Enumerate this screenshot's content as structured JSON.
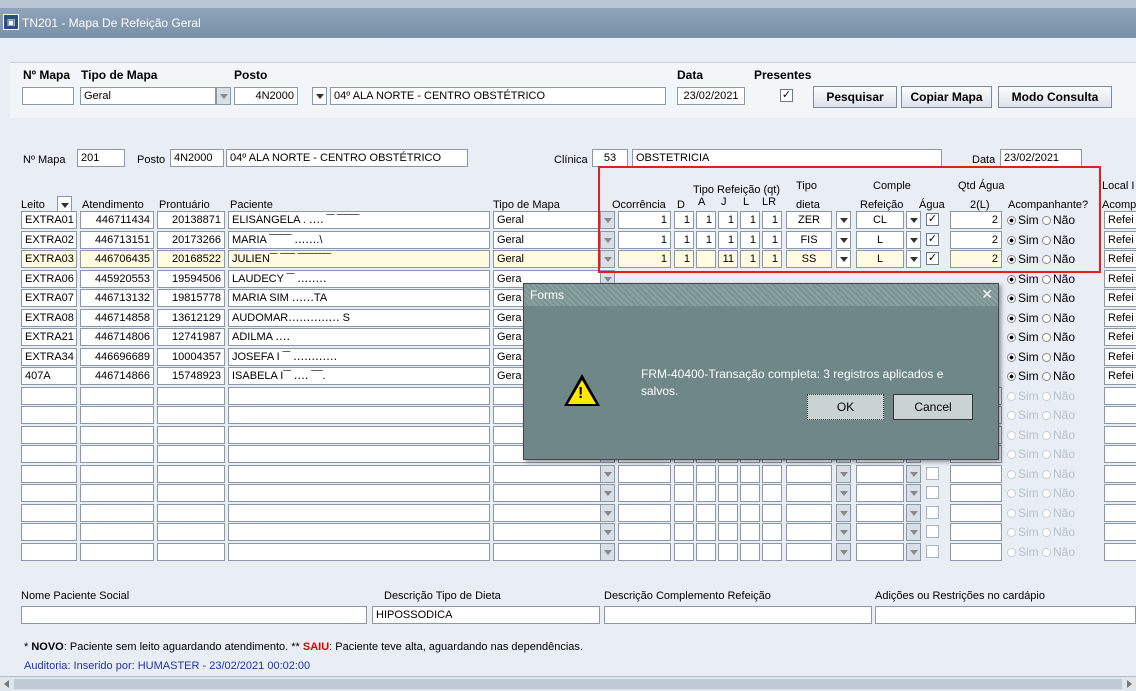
{
  "window": {
    "title": "TN201 - Mapa De Refeição Geral",
    "icon": "app-icon"
  },
  "search": {
    "labels": {
      "mapa": "Nº Mapa",
      "tipo": "Tipo de Mapa",
      "posto": "Posto",
      "data": "Data",
      "presentes": "Presentes"
    },
    "mapa_value": "",
    "tipo_value": "Geral",
    "posto_code": "4N2000",
    "posto_name": "04º ALA NORTE - CENTRO OBSTÉTRICO",
    "data_value": "23/02/2021",
    "presentes_checked": "✓",
    "buttons": {
      "pesquisar": "Pesquisar",
      "copiar": "Copiar Mapa",
      "consulta": "Modo Consulta"
    }
  },
  "header": {
    "labels": {
      "mapa": "Nº Mapa",
      "posto": "Posto",
      "clinica": "Clínica",
      "data": "Data"
    },
    "mapa_value": "201",
    "posto_code": "4N2000",
    "posto_name": "04º ALA NORTE - CENTRO OBSTÉTRICO",
    "clinica_code": "53",
    "clinica_name": "OBSTETRICIA",
    "data_value": "23/02/2021"
  },
  "columns": {
    "leito": "Leito",
    "atendimento": "Atendimento",
    "prontuario": "Prontuário",
    "paciente": "Paciente",
    "tipo_mapa": "Tipo de Mapa",
    "ocorrencia": "Ocorrência",
    "tipo_refeicao": "Tipo Refeição (qt)",
    "d": "D",
    "a": "A",
    "j": "J",
    "l": "L",
    "lr": "LR",
    "tipo_dieta_1": "Tipo",
    "tipo_dieta_2": "dieta",
    "comple_1": "Comple",
    "comple_2": "Refeição",
    "agua": "Água",
    "qtd_1": "Qtd Água",
    "qtd_2": "2(L)",
    "acomp": "Acompanhante?",
    "local_1": "Local I",
    "local_2": "Acomp"
  },
  "rows": [
    {
      "leito": "EXTRA01",
      "atendimento": "446711434",
      "prontuario": "20138871",
      "paciente": "ELISANGELA .   ‥‥ ‾‾ ‾‾‾‾‾‾",
      "tipo": "Geral",
      "oc": "1",
      "d": "1",
      "a": "1",
      "j": "1",
      "l": "1",
      "lr": "1",
      "dieta": "ZER",
      "comple": "CL",
      "agua": "✓",
      "qtd": "2",
      "sim": "Sim",
      "nao": "Não",
      "local": "Refei"
    },
    {
      "leito": "EXTRA02",
      "atendimento": "446713151",
      "prontuario": "20173266",
      "paciente": "MARIA      ‾‾‾‾‾‾  ‥‥‥.\\",
      "tipo": "Geral",
      "oc": "1",
      "d": "1",
      "a": "1",
      "j": "1",
      "l": "1",
      "lr": "1",
      "dieta": "FIS",
      "comple": "L",
      "agua": "✓",
      "qtd": "2",
      "sim": "Sim",
      "nao": "Não",
      "local": "Refei"
    },
    {
      "leito": "EXTRA03",
      "atendimento": "446706435",
      "prontuario": "20168522",
      "paciente": "JULIEN‾‾ ‾‾‾‾  ‾‾‾‾‾‾‾‾‾",
      "tipo": "Geral",
      "oc": "1",
      "d": "1",
      "a": "",
      "j": "11",
      "l": "1",
      "lr": "1",
      "dieta": "SS",
      "comple": "L",
      "agua": "✓",
      "qtd": "2",
      "sim": "Sim",
      "nao": "Não",
      "local": "Refei"
    },
    {
      "leito": "EXTRA06",
      "atendimento": "445920553",
      "prontuario": "19594506",
      "paciente": "LAUDECY   ‾‾   ‥‥‥‥",
      "tipo": "Gera",
      "sim": "Sim",
      "nao": "Não",
      "local": "Refei"
    },
    {
      "leito": "EXTRA07",
      "atendimento": "446713132",
      "prontuario": "19815778",
      "paciente": "MARIA SIM                   ‥‥‥TA",
      "tipo": "Gera",
      "sim": "Sim",
      "nao": "Não",
      "local": "Refei"
    },
    {
      "leito": "EXTRA08",
      "atendimento": "446714858",
      "prontuario": "13612129",
      "paciente": "AUDOMAR‥‥‥‥‥‥‥   S",
      "tipo": "Gera",
      "sim": "Sim",
      "nao": "Não",
      "local": "Refei"
    },
    {
      "leito": "EXTRA21",
      "atendimento": "446714806",
      "prontuario": "12741987",
      "paciente": "ADILMA                       ‥‥",
      "tipo": "Gera",
      "sim": "Sim",
      "nao": "Não",
      "local": "Refei"
    },
    {
      "leito": "EXTRA34",
      "atendimento": "446696689",
      "prontuario": "10004357",
      "paciente": "JOSEFA I ‾‾   ‥‥‥‥‥‥",
      "tipo": "Gera",
      "sim": "Sim",
      "nao": "Não",
      "local": "Refei"
    },
    {
      "leito": "407A",
      "atendimento": "446714866",
      "prontuario": "15748923",
      "paciente": "ISABELA I‾‾   ‥‥   ‾‾‾.",
      "tipo": "Gera",
      "sim": "Sim",
      "nao": "Não",
      "local": "Refei"
    }
  ],
  "empty_radio": {
    "sim": "Sim",
    "nao": "Não"
  },
  "bottom": {
    "nome_social": "Nome Paciente Social",
    "desc_dieta": "Descrição Tipo de Dieta",
    "desc_dieta_value": "HIPOSSODICA",
    "desc_comple": "Descrição Complemento Refeição",
    "adicoes": "Adições ou Restrições no cardápio"
  },
  "notes": {
    "prefix": "* ",
    "novo": "NOVO",
    "novo_text": ": Paciente sem leito aguardando atendimento. ** ",
    "saiu": "SAIU",
    "saiu_text": ": Paciente teve alta, aguardando nas dependências.",
    "audit": "Auditoria: Inserido por: HUMASTER - 23/02/2021 00:02:00"
  },
  "dialog": {
    "title": "Forms",
    "message": "FRM-40400-Transação completa: 3 registros aplicados e salvos.",
    "ok": "OK",
    "cancel": "Cancel",
    "icon": "warning-icon"
  },
  "colors": {
    "highlight_box": "#e02020",
    "selected_row": "#fffbe0",
    "dialog_bg": "#6f8887"
  }
}
